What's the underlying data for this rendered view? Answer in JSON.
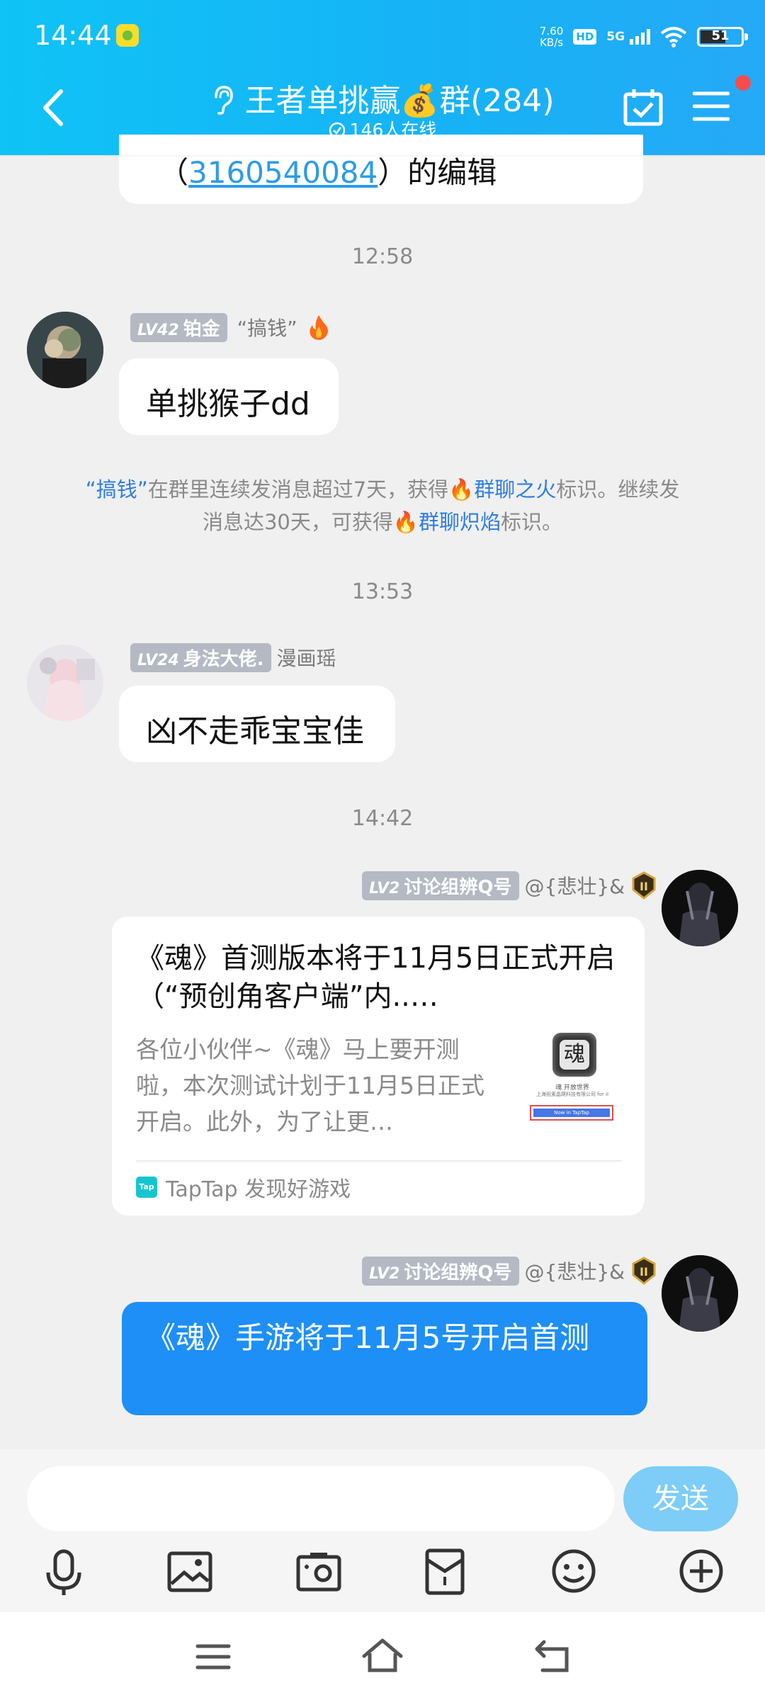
{
  "status_bar": {
    "time": "14:44",
    "speed_value": "7.60",
    "speed_unit": "KB/s",
    "hd": "HD",
    "network": "5G",
    "battery": "51"
  },
  "header": {
    "title": "王者单挑赢💰群(284)",
    "online": "146人在线"
  },
  "messages": {
    "top_partial": {
      "prefix": "（",
      "link": "3160540084",
      "suffix": "）的编辑"
    },
    "t1": "12:58",
    "m1": {
      "level": "LV42",
      "title": "铂金",
      "nickname": "“搞钱”",
      "text": "单挑猴子dd"
    },
    "system": {
      "p1": "“搞钱”",
      "p2": "在群里连续发消息超过7天，获得",
      "p3": "群聊之火",
      "p4": "标识。继续发",
      "p5": "消息达30天，可获得",
      "p6": "群聊炽焰",
      "p7": "标识。"
    },
    "t2": "13:53",
    "m2": {
      "level": "LV24",
      "title": "身法大佬.",
      "nickname": "漫画瑶",
      "text": "凶不走乖宝宝佳"
    },
    "t3": "14:42",
    "m3": {
      "level": "LV2",
      "title": "讨论组辨Q号",
      "nickname": "@{悲壮}&",
      "card_title": "《魂》首测版本将于11月5日正式开启（“预创角客户端”内..…",
      "card_desc": "各位小伙伴~《魂》马上要开测啦，本次测试计划于11月5日正式开启。此外，为了让更…",
      "thumb_caption1": "魂 开放世界",
      "thumb_caption2": "上海祝素晶飓科技有限公司 for iI",
      "thumb_button": "Now in TapTap",
      "source_logo": "Tap",
      "source": "TapTap 发现好游戏"
    },
    "m4": {
      "level": "LV2",
      "title": "讨论组辨Q号",
      "nickname": "@{悲壮}&",
      "text": "《魂》手游将于11月5号开启首测"
    }
  },
  "input": {
    "placeholder": "",
    "send_label": "发送"
  },
  "colors": {
    "header": "#17b2f6",
    "self_bubble": "#1e8ff6",
    "send_button": "#7dcdf8",
    "link": "#2d7ee4"
  }
}
